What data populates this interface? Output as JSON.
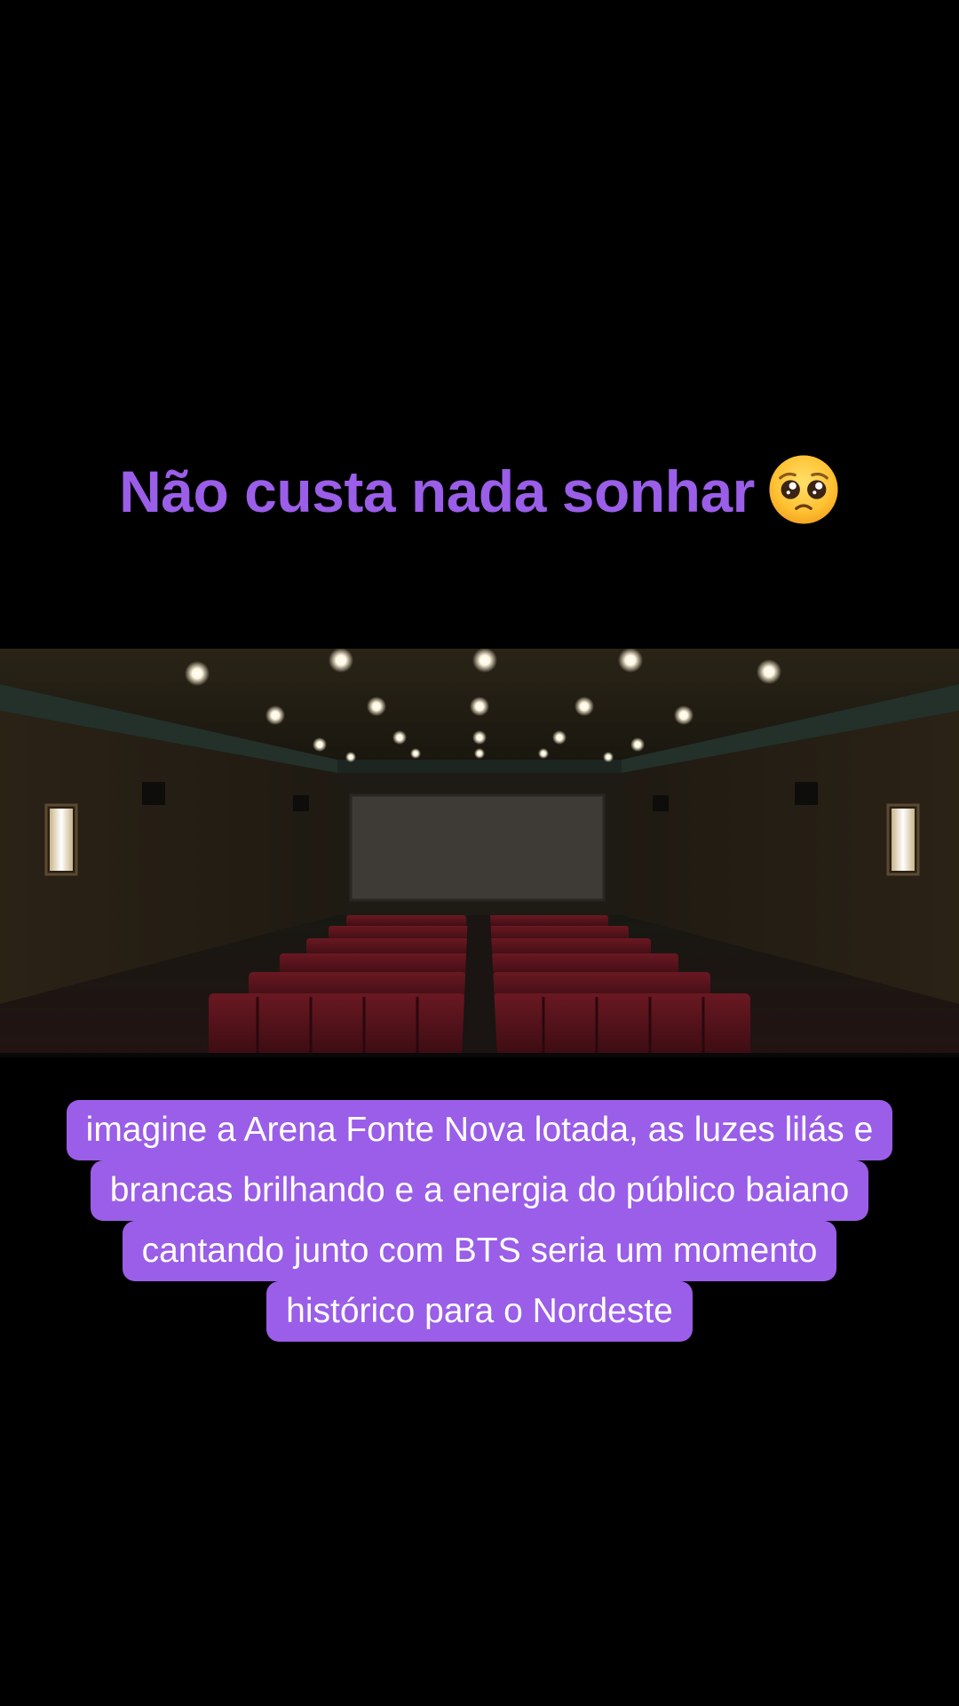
{
  "title": {
    "text": "Não custa nada sonhar",
    "emoji_icon": "pleading-face-icon"
  },
  "scene": {
    "description_icon": "cinema-auditorium-image"
  },
  "caption": {
    "lines": [
      "imagine a Arena Fonte Nova lotada, as luzes lilás e",
      "brancas brilhando e a energia do público baiano",
      "cantando junto com BTS seria um momento",
      "histórico para o Nordeste"
    ],
    "background_color": "#9a5ee8",
    "text_color": "#ffffff"
  },
  "colors": {
    "accent": "#9a5ee8",
    "background": "#000000"
  }
}
